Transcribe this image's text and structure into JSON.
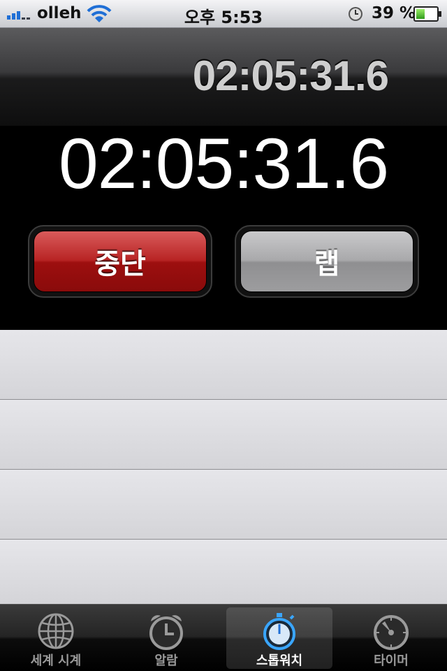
{
  "status_bar": {
    "carrier": "olleh",
    "time": "오후 5:53",
    "battery_percent": "39 %",
    "battery_level": 0.39,
    "icons": [
      "signal-bars-icon",
      "wifi-icon",
      "alarm-clock-status-icon",
      "battery-icon"
    ]
  },
  "stopwatch": {
    "lap_time": "02:05:31.6",
    "total_time": "02:05:31.6"
  },
  "buttons": {
    "stop_label": "중단",
    "lap_label": "랩"
  },
  "laps": [],
  "tab_bar": {
    "tabs": [
      {
        "label": "세계 시계",
        "icon": "globe-icon",
        "active": false
      },
      {
        "label": "알람",
        "icon": "alarm-clock-icon",
        "active": false
      },
      {
        "label": "스톱워치",
        "icon": "stopwatch-icon",
        "active": true
      },
      {
        "label": "타이머",
        "icon": "timer-icon",
        "active": false
      }
    ]
  },
  "colors": {
    "stop_button": "#a31414",
    "lap_button": "#9d9d9f",
    "active_tab_icon": "#3aa6ff",
    "signal_blue": "#1f6fd6",
    "battery_green": "#4fc12c"
  }
}
